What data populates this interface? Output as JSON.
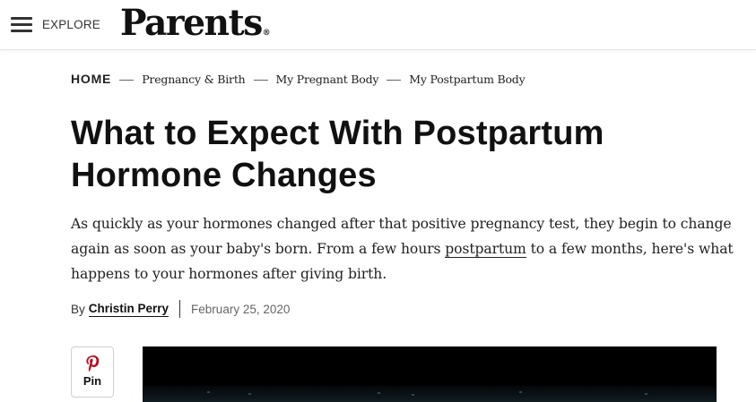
{
  "header": {
    "menu_label": "EXPLORE",
    "logo_text": "Parents",
    "logo_mark": "®"
  },
  "breadcrumb": {
    "items": [
      "HOME",
      "Pregnancy & Birth",
      "My Pregnant Body",
      "My Postpartum Body"
    ]
  },
  "article": {
    "title": "What to Expect With Postpartum Hormone Changes",
    "dek_before_link": "As quickly as your hormones changed after that positive pregnancy test, they begin to change again as soon as your baby's born. From a few hours ",
    "dek_link": "postpartum",
    "dek_after_link": " to a few months, here's what happens to your hormones after giving birth.",
    "by_label": "By",
    "author": "Christin Perry",
    "date": "February 25, 2020"
  },
  "share": {
    "pin_label": "Pin",
    "pin_icon": "pinterest-icon",
    "accent_color": "#bd081c"
  },
  "colors": {
    "text": "#1a1a1a",
    "muted": "#666666",
    "hero_background": "#000000"
  }
}
